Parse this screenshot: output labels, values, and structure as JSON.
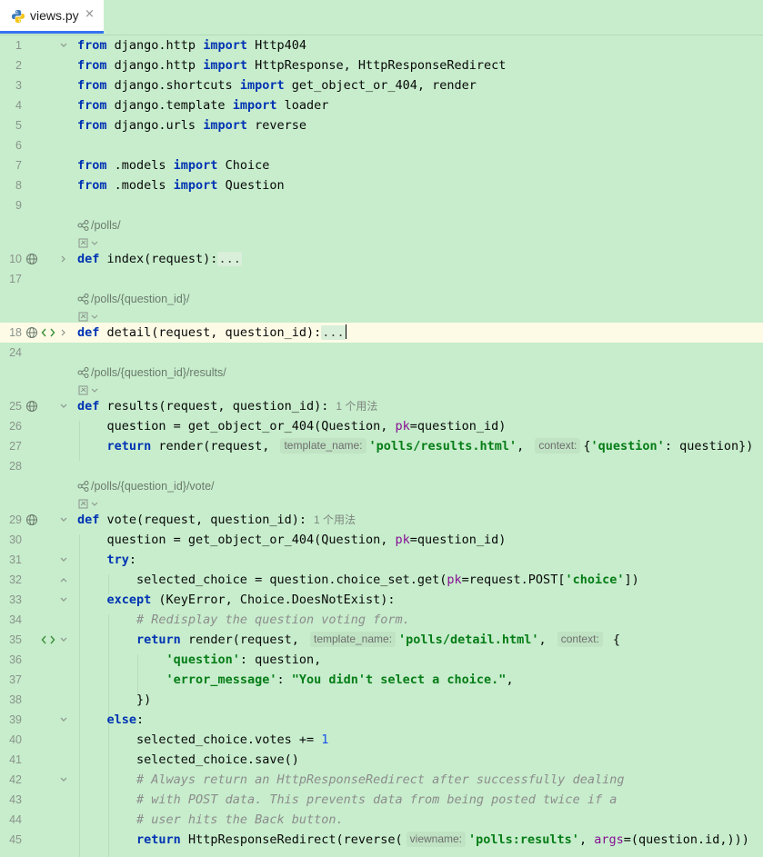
{
  "tab": {
    "filename": "views.py",
    "close": "×"
  },
  "colors": {
    "background": "#c7edcc",
    "keyword": "#0033b3",
    "string": "#067d17",
    "comment": "#8c8c8c",
    "tab_underline": "#3574f0"
  },
  "line_numbers": [
    "1",
    "2",
    "3",
    "4",
    "5",
    "6",
    "7",
    "8",
    "9",
    "10",
    "17",
    "18",
    "24",
    "25",
    "26",
    "27",
    "28",
    "29",
    "30",
    "31",
    "32",
    "33",
    "34",
    "35",
    "36",
    "37",
    "38",
    "39",
    "40",
    "41",
    "42",
    "43",
    "44",
    "45"
  ],
  "routes": {
    "index": "/polls/",
    "detail": "/polls/{question_id}/",
    "results": "/polls/{question_id}/results/",
    "vote": "/polls/{question_id}/vote/"
  },
  "usages": {
    "results": "1 个用法",
    "vote": "1 个用法"
  },
  "hints": {
    "template_name": "template_name:",
    "context": "context:",
    "viewname": "viewname:"
  },
  "code": {
    "l1": [
      "from",
      " django.http ",
      "import",
      " Http404"
    ],
    "l2": [
      "from",
      " django.http ",
      "import",
      " HttpResponse, HttpResponseRedirect"
    ],
    "l3": [
      "from",
      " django.shortcuts ",
      "import",
      " get_object_or_404, render"
    ],
    "l4": [
      "from",
      " django.template ",
      "import",
      " loader"
    ],
    "l5": [
      "from",
      " django.urls ",
      "import",
      " reverse"
    ],
    "l7": [
      "from",
      " .models ",
      "import",
      " Choice"
    ],
    "l8": [
      "from",
      " .models ",
      "import",
      " Question"
    ],
    "l10": [
      "def",
      " index(request):",
      "..."
    ],
    "l18": [
      "def",
      " detail(request, question_id):",
      "..."
    ],
    "l25": [
      "def",
      " results(request, question_id):"
    ],
    "l26": "    question = get_object_or_404(Question, ",
    "l26b": "pk",
    "l26c": "=question_id)",
    "l27a": "    ",
    "l27kw": "return",
    "l27b": " render(request, ",
    "l27str": "'polls/results.html'",
    "l27c": ", ",
    "l27d": "{",
    "l27str2": "'question'",
    "l27e": ": question})",
    "l29": [
      "def",
      " vote(request, question_id):"
    ],
    "l30a": "    question = get_object_or_404(Question, ",
    "l30b": "pk",
    "l30c": "=question_id)",
    "l31": "try",
    "l32a": "        selected_choice = question.choice_set.get(",
    "l32b": "pk",
    "l32c": "=request.POST[",
    "l32str": "'choice'",
    "l32d": "])",
    "l33kw": "except",
    "l33b": " (KeyError, Choice.DoesNotExist):",
    "l34": "# Redisplay the question voting form.",
    "l35kw": "return",
    "l35b": " render(request, ",
    "l35str": "'polls/detail.html'",
    "l35c": ", ",
    "l35d": " {",
    "l36str": "'question'",
    "l36b": ": question,",
    "l37str": "'error_message'",
    "l37b": ": ",
    "l37str2": "\"You didn't select a choice.\"",
    "l37c": ",",
    "l38": "})",
    "l39": "else",
    "l40a": "        selected_choice.votes += ",
    "l40num": "1",
    "l41": "        selected_choice.save()",
    "l42": "# Always return an HttpResponseRedirect after successfully dealing",
    "l43": "# with POST data. This prevents data from being posted twice if a",
    "l44": "# user hits the Back button.",
    "l45kw": "return",
    "l45b": " HttpResponseRedirect(reverse(",
    "l45str": "'polls:results'",
    "l45c": ", ",
    "l45param": "args",
    "l45d": "=(question.id,)))"
  }
}
